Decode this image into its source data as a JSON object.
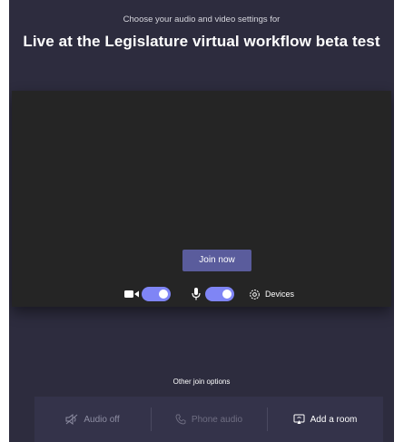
{
  "header": {
    "subtitle": "Choose your audio and video settings for",
    "meeting_title": "Live at the Legislature virtual workflow beta test"
  },
  "preview": {
    "join_button_label": "Join now",
    "camera_toggle_on": true,
    "mic_toggle_on": true,
    "devices_label": "Devices"
  },
  "other_options": {
    "heading": "Other join options",
    "items": [
      {
        "label": "Audio off",
        "icon": "speaker-off-icon"
      },
      {
        "label": "Phone audio",
        "icon": "phone-icon"
      },
      {
        "label": "Add a room",
        "icon": "room-cast-icon"
      }
    ]
  },
  "colors": {
    "background": "#2d2c3e",
    "preview": "#252525",
    "accent": "#7f85f5",
    "join_button": "#5a5c9c",
    "options_bar": "#34334a"
  }
}
